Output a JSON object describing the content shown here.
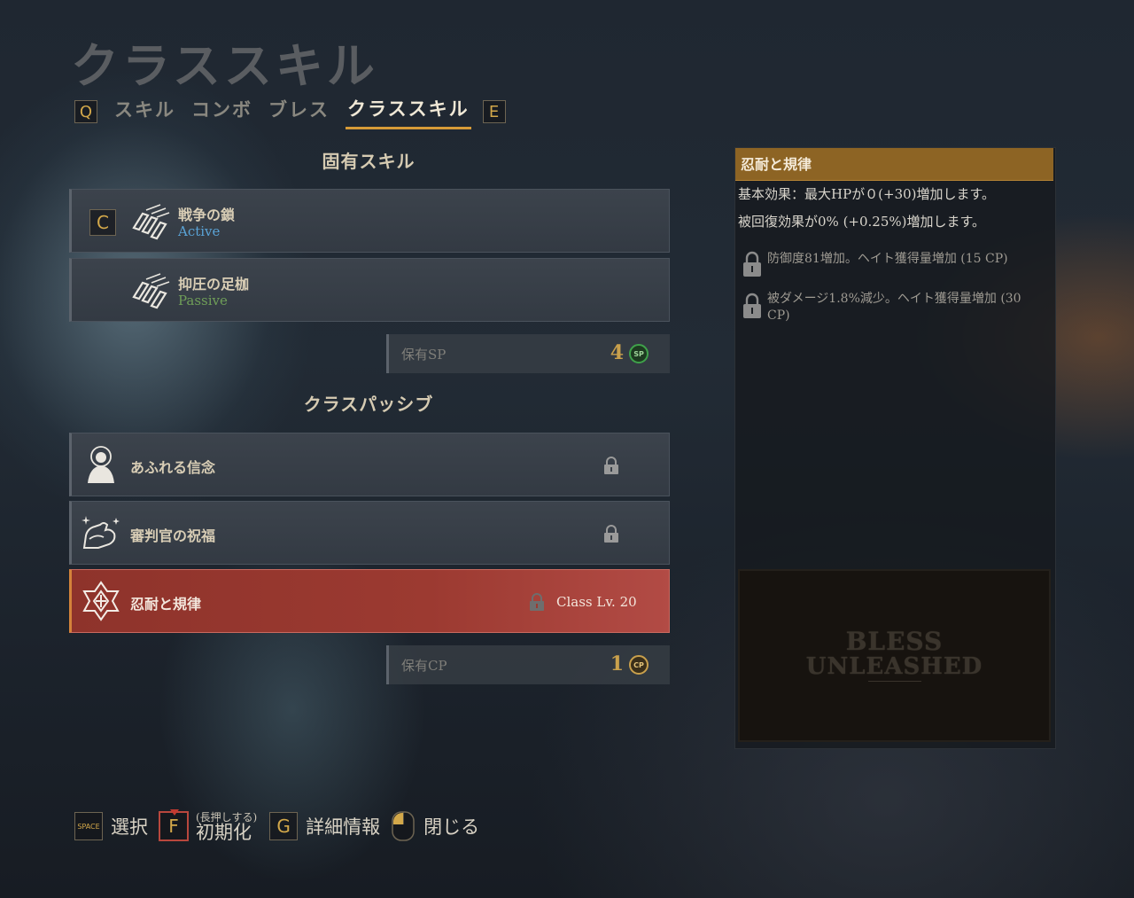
{
  "page_title": "クラススキル",
  "tabs": {
    "prev_key": "Q",
    "next_key": "E",
    "items": [
      {
        "label": "スキル",
        "active": false
      },
      {
        "label": "コンボ",
        "active": false
      },
      {
        "label": "ブレス",
        "active": false
      },
      {
        "label": "クラススキル",
        "active": true
      }
    ]
  },
  "innate": {
    "heading": "固有スキル",
    "items": [
      {
        "key": "C",
        "name": "戦争の鎖",
        "type": "Active",
        "icon": "chains-icon"
      },
      {
        "name": "抑圧の足枷",
        "type": "Passive",
        "icon": "chains-icon"
      }
    ],
    "sp": {
      "label": "保有SP",
      "value": "4",
      "badge": "SP",
      "badge_color": "#3fa14a"
    }
  },
  "class_passive": {
    "heading": "クラスパッシブ",
    "items": [
      {
        "name": "あふれる信念",
        "icon": "saint-icon",
        "locked": true
      },
      {
        "name": "審判官の祝福",
        "icon": "flexed-arm-icon",
        "locked": true
      },
      {
        "name": "忍耐と規律",
        "icon": "crest-icon",
        "locked": true,
        "requirement": "Class Lv. 20",
        "selected": true
      }
    ],
    "cp": {
      "label": "保有CP",
      "value": "1",
      "badge": "CP",
      "badge_color": "#c9a04c"
    }
  },
  "detail": {
    "title": "忍耐と規律",
    "lines": [
      "基本効果：最大HPが０(+30)増加します。",
      "被回復効果が0% (+0.25%)増加します。"
    ],
    "perks": [
      {
        "text": "防御度81増加。ヘイト獲得量増加 (15 CP)",
        "locked": true
      },
      {
        "text": "被ダメージ1.8%減少。ヘイト獲得量増加 (30 CP)",
        "locked": true
      }
    ],
    "logo": {
      "line1": "BLESS",
      "line2": "UNLEASHED"
    }
  },
  "footer": {
    "select_key": "SPACE",
    "select_label": "選択",
    "reset_key": "F",
    "reset_hint": "(長押しする)",
    "reset_label": "初期化",
    "details_key": "G",
    "details_label": "詳細情報",
    "close_label": "閉じる"
  },
  "colors": {
    "accent": "#d69b38",
    "selected_row": "#9c3a31",
    "active_text": "#5aa3d6",
    "passive_text": "#6f9e58"
  }
}
